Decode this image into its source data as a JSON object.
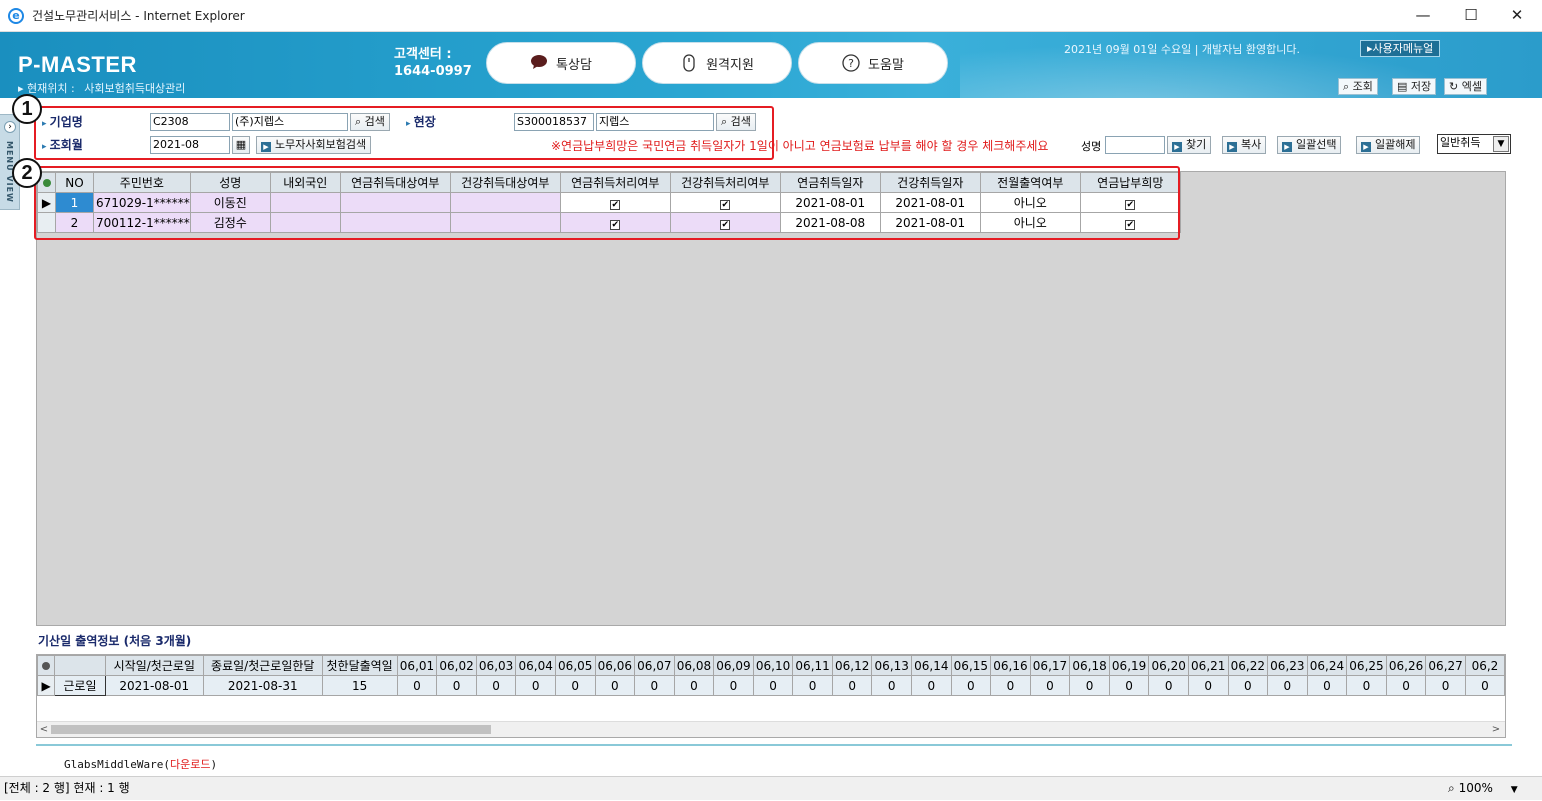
{
  "window": {
    "title": "건설노무관리서비스 - Internet Explorer",
    "minimize": "—",
    "maximize": "☐",
    "close": "✕"
  },
  "header": {
    "logo": "P-MASTER",
    "location_label": "현재위치 :",
    "location_value": "사회보험취득대상관리",
    "cc_label": "고객센터 :",
    "cc_phone": "1644-0997",
    "buttons": [
      {
        "label": "톡상담",
        "icon": "chat-bubble-icon"
      },
      {
        "label": "원격지원",
        "icon": "mouse-icon"
      },
      {
        "label": "도움말",
        "icon": "question-icon"
      }
    ],
    "greeting": "2021년 09월 01일 수요일 | 개발자님 환영합니다.",
    "user_menu": "▸사용자메뉴얼",
    "actions": [
      {
        "label": "조회",
        "icon": "search-icon"
      },
      {
        "label": "저장",
        "icon": "save-icon"
      },
      {
        "label": "엑셀",
        "icon": "excel-icon"
      }
    ]
  },
  "sidebar": {
    "tab_label": "MENU VIEW",
    "toggle": "›"
  },
  "markers": {
    "one": "1",
    "two": "2"
  },
  "filter": {
    "company_label": "기업명",
    "company_code": "C2308",
    "company_name": "(주)지렙스",
    "search_btn": "검색",
    "site_label": "현장",
    "site_code": "S300018537",
    "site_name": "지렙스",
    "month_label": "조회월",
    "month_value": "2021-08",
    "insurance_search_btn": "노무자사회보험검색",
    "notice": "※연금납부희망은 국민연금 취득일자가 1일이 아니고 연금보험료 납부를 해야 할 경우 체크해주세요",
    "name_label": "성명",
    "name_value": "",
    "find_btn": "찾기",
    "copy_btn": "복사",
    "select_all_btn": "일괄선택",
    "deselect_all_btn": "일괄해제",
    "type_select": "일반취득"
  },
  "grid": {
    "columns": [
      "NO",
      "주민번호",
      "성명",
      "내외국인",
      "연금취득대상여부",
      "건강취득대상여부",
      "연금취득처리여부",
      "건강취득처리여부",
      "연금취득일자",
      "건강취득일자",
      "전월출역여부",
      "연금납부희망"
    ],
    "rows": [
      {
        "no": "1",
        "rrn": "671029-1******",
        "name": "이동진",
        "foreign": "",
        "pen_target": "",
        "hlth_target": "",
        "pen_done": "✔",
        "hlth_done": "✔",
        "pen_date": "2021-08-01",
        "hlth_date": "2021-08-01",
        "prev_month": "아니오",
        "pen_hope": "✔"
      },
      {
        "no": "2",
        "rrn": "700112-1******",
        "name": "김정수",
        "foreign": "",
        "pen_target": "",
        "hlth_target": "",
        "pen_done": "✔",
        "hlth_done": "✔",
        "pen_date": "2021-08-08",
        "hlth_date": "2021-08-01",
        "prev_month": "아니오",
        "pen_hope": "✔"
      }
    ]
  },
  "attendance": {
    "title": "기산일 출역정보 (처음 3개월)",
    "columns": [
      "",
      "시작일/첫근로일",
      "종료일/첫근로일한달",
      "첫한달출역일",
      "06,01",
      "06,02",
      "06,03",
      "06,04",
      "06,05",
      "06,06",
      "06,07",
      "06,08",
      "06,09",
      "06,10",
      "06,11",
      "06,12",
      "06,13",
      "06,14",
      "06,15",
      "06,16",
      "06,17",
      "06,18",
      "06,19",
      "06,20",
      "06,21",
      "06,22",
      "06,23",
      "06,24",
      "06,25",
      "06,26",
      "06,27",
      "06,2"
    ],
    "row": [
      "근로일",
      "2021-08-01",
      "2021-08-31",
      "15",
      "0",
      "0",
      "0",
      "0",
      "0",
      "0",
      "0",
      "0",
      "0",
      "0",
      "0",
      "0",
      "0",
      "0",
      "0",
      "0",
      "0",
      "0",
      "0",
      "0",
      "0",
      "0",
      "0",
      "0",
      "0",
      "0",
      "0",
      "0"
    ],
    "scroll_left": "<",
    "scroll_right": ">"
  },
  "middleware": {
    "name": "GlabsMiddleWare(",
    "link": "다운로드",
    "end": ")"
  },
  "status": {
    "left": "[전체 : 2 행] 현재 : 1 행",
    "zoom": "100%"
  }
}
